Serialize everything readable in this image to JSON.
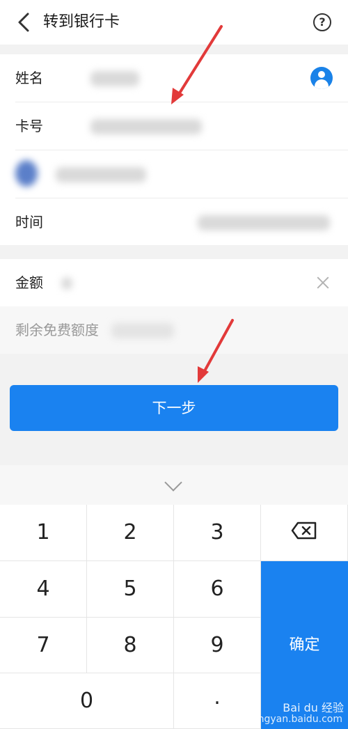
{
  "header": {
    "title": "转到银行卡",
    "back_icon": "chevron-left-icon",
    "help_icon": "question-circle-icon"
  },
  "form": {
    "name_label": "姓名",
    "card_label": "卡号",
    "time_label": "时间",
    "amount_label": "金额",
    "quota_label": "剩余免费额度"
  },
  "next_button": {
    "label": "下一步"
  },
  "keyboard": {
    "keys": [
      "1",
      "2",
      "3",
      "4",
      "5",
      "6",
      "7",
      "8",
      "9",
      "0",
      "."
    ],
    "confirm_label": "确定",
    "delete_icon": "backspace-icon",
    "collapse_icon": "chevron-down-icon"
  },
  "watermark": {
    "logo": "Bai du 经验",
    "url": "jingyan.baidu.com"
  },
  "colors": {
    "accent": "#1a82f0",
    "arrow": "#e23a3a"
  }
}
